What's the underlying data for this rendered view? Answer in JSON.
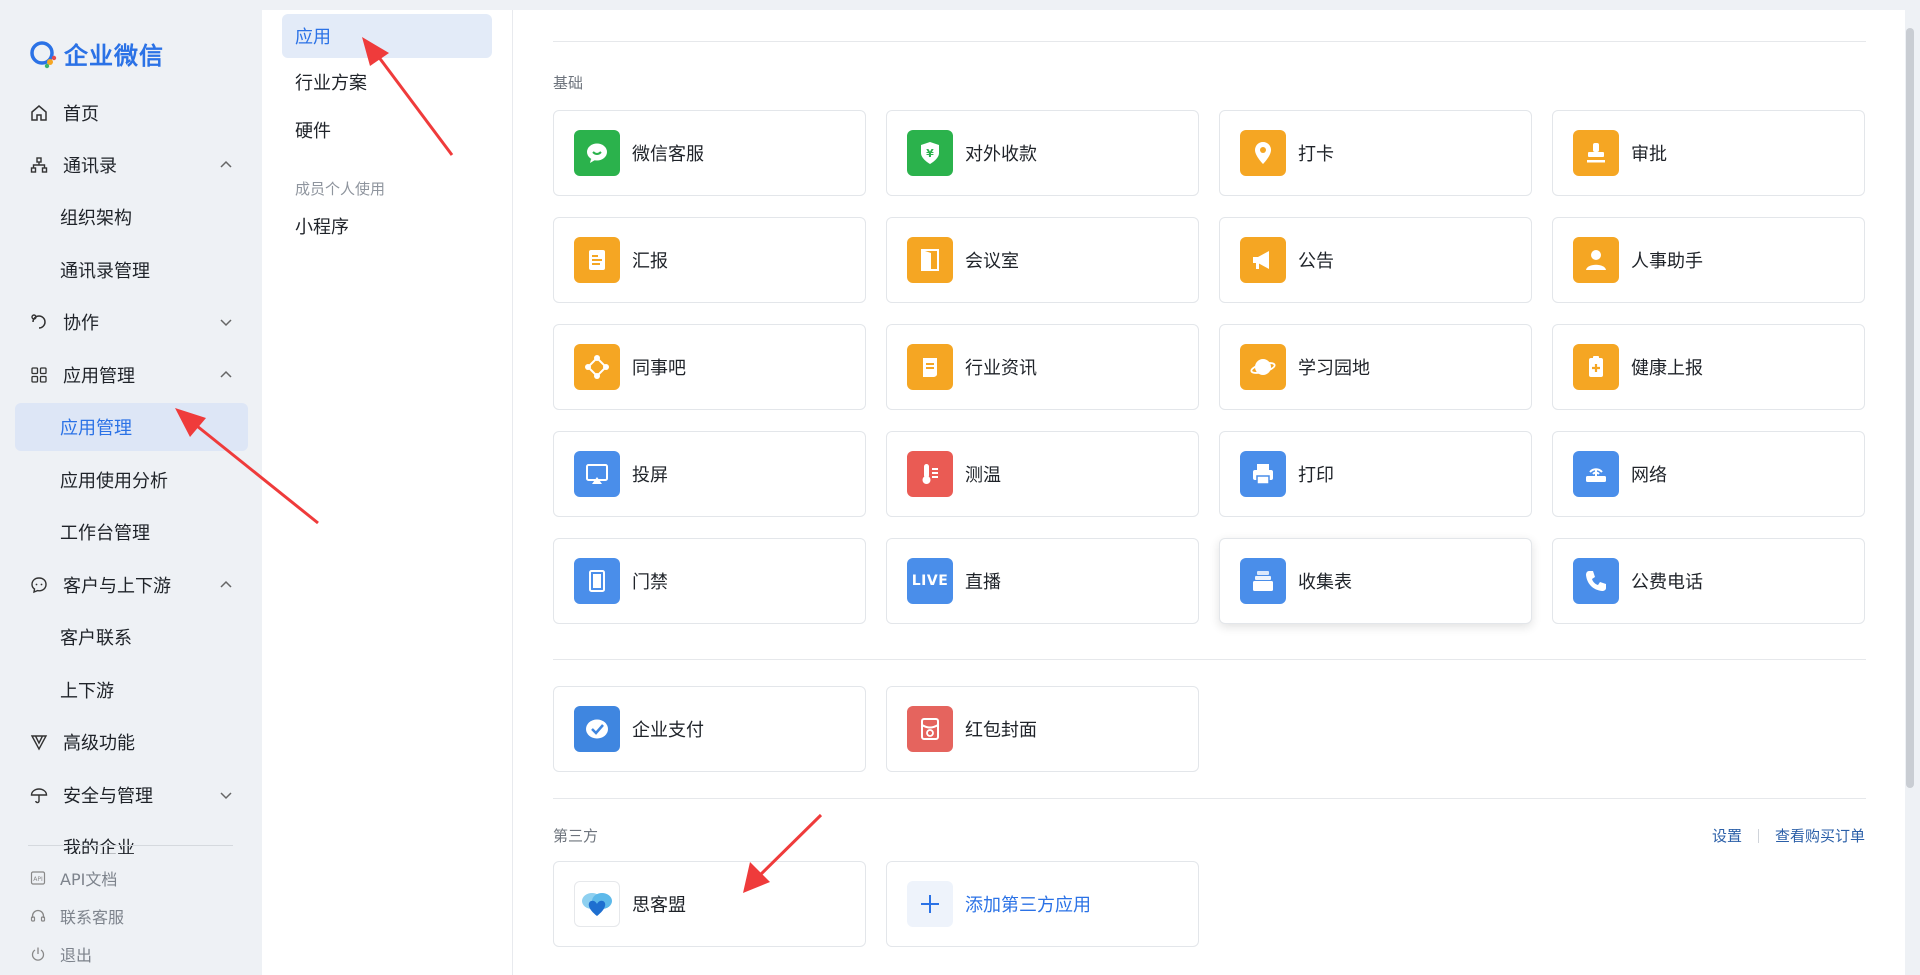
{
  "app": {
    "logo_text": "企业微信"
  },
  "sidebar": {
    "items": [
      {
        "label": "首页"
      },
      {
        "label": "通讯录"
      },
      {
        "label": "组织架构"
      },
      {
        "label": "通讯录管理"
      },
      {
        "label": "协作"
      },
      {
        "label": "应用管理"
      },
      {
        "label": "应用管理"
      },
      {
        "label": "应用使用分析"
      },
      {
        "label": "工作台管理"
      },
      {
        "label": "客户与上下游"
      },
      {
        "label": "客户联系"
      },
      {
        "label": "上下游"
      },
      {
        "label": "高级功能"
      },
      {
        "label": "安全与管理"
      },
      {
        "label": "我的企业"
      }
    ],
    "footer": [
      {
        "label": "API文档"
      },
      {
        "label": "联系客服"
      },
      {
        "label": "退出"
      }
    ]
  },
  "subnav": {
    "items": [
      {
        "label": "应用"
      },
      {
        "label": "行业方案"
      },
      {
        "label": "硬件"
      }
    ],
    "group_title": "成员个人使用",
    "group_items": [
      {
        "label": "小程序"
      }
    ]
  },
  "main": {
    "basic_title": "基础",
    "basic_apps": [
      {
        "label": "微信客服",
        "icon": "wechat-service-icon",
        "color": "#2bb24c"
      },
      {
        "label": "对外收款",
        "icon": "payment-shield-icon",
        "color": "#2bb24c"
      },
      {
        "label": "打卡",
        "icon": "location-pin-icon",
        "color": "#f5a623"
      },
      {
        "label": "审批",
        "icon": "stamp-icon",
        "color": "#f5a623"
      },
      {
        "label": "汇报",
        "icon": "report-icon",
        "color": "#f5a623"
      },
      {
        "label": "会议室",
        "icon": "door-icon",
        "color": "#f5a623"
      },
      {
        "label": "公告",
        "icon": "megaphone-icon",
        "color": "#f5a623"
      },
      {
        "label": "人事助手",
        "icon": "person-icon",
        "color": "#f5a623"
      },
      {
        "label": "同事吧",
        "icon": "network-icon",
        "color": "#f5a623"
      },
      {
        "label": "行业资讯",
        "icon": "scroll-icon",
        "color": "#f5a623"
      },
      {
        "label": "学习园地",
        "icon": "planet-icon",
        "color": "#f5a623"
      },
      {
        "label": "健康上报",
        "icon": "clipboard-plus-icon",
        "color": "#f5a623"
      },
      {
        "label": "投屏",
        "icon": "screencast-icon",
        "color": "#4a8eea"
      },
      {
        "label": "测温",
        "icon": "thermometer-icon",
        "color": "#ea5b54"
      },
      {
        "label": "打印",
        "icon": "printer-icon",
        "color": "#4a8eea"
      },
      {
        "label": "网络",
        "icon": "router-icon",
        "color": "#4a8eea"
      },
      {
        "label": "门禁",
        "icon": "access-door-icon",
        "color": "#4a8eea"
      },
      {
        "label": "直播",
        "icon": "live-icon",
        "color": "#4a8eea",
        "icon_text": "LIVE"
      },
      {
        "label": "收集表",
        "icon": "box-icon",
        "color": "#4a8eea"
      },
      {
        "label": "公费电话",
        "icon": "phone-icon",
        "color": "#4a8eea"
      }
    ],
    "pay_apps": [
      {
        "label": "企业支付",
        "icon": "wechat-pay-icon",
        "color": "#3f86e0"
      },
      {
        "label": "红包封面",
        "icon": "red-envelope-icon",
        "color": "#e5645e"
      }
    ],
    "third_title": "第三方",
    "third_links": {
      "settings": "设置",
      "orders": "查看购买订单"
    },
    "third_apps": [
      {
        "label": "思客盟",
        "icon": "sikemeng-logo-icon"
      },
      {
        "label": "添加第三方应用",
        "icon": "plus-icon"
      }
    ]
  }
}
